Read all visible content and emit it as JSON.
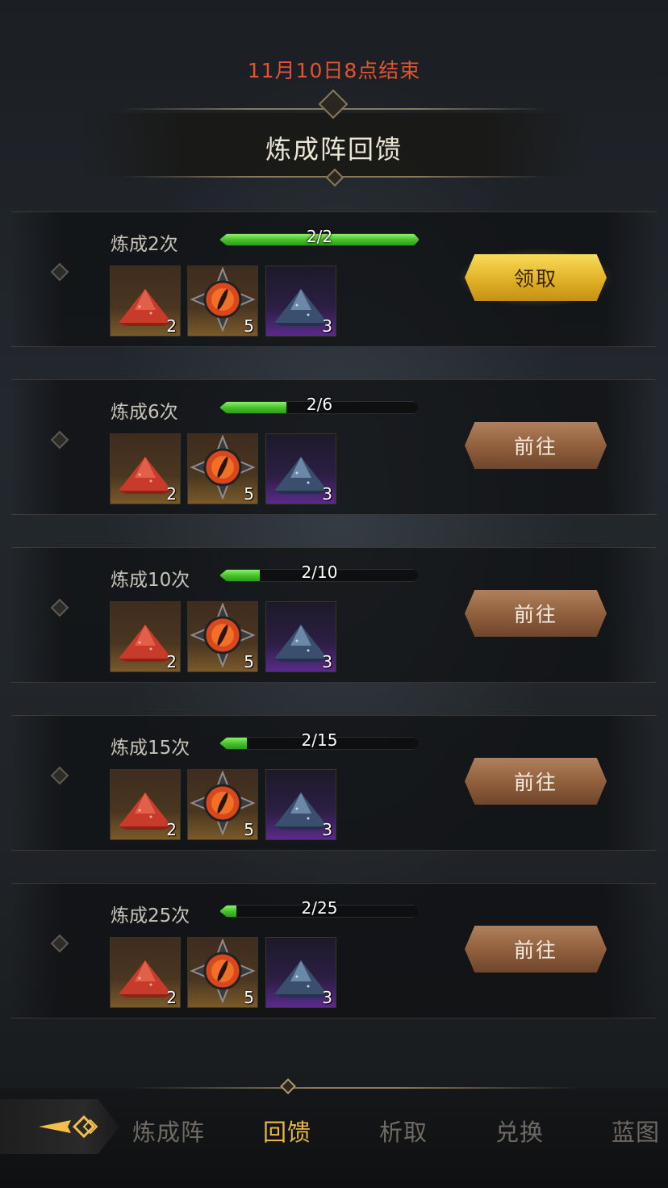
{
  "event": {
    "end_time": "11月10日8点结束",
    "title": "炼成阵回馈"
  },
  "colors": {
    "accent_red": "#e2532f",
    "progress_green": "#47c42a",
    "claim_gold": "#e4b52a",
    "goto_brown": "#8e5e3c",
    "active_tab": "#e8b845"
  },
  "rewards": [
    {
      "label": "炼成2次",
      "progress_text": "2/2",
      "progress_fraction": 1.0,
      "button": "领取",
      "button_type": "claim",
      "items": [
        {
          "icon": "red-crystal-pile-icon",
          "count": "2"
        },
        {
          "icon": "dragon-eye-orb-icon",
          "count": "5"
        },
        {
          "icon": "blue-crystal-pile-icon",
          "count": "3"
        }
      ]
    },
    {
      "label": "炼成6次",
      "progress_text": "2/6",
      "progress_fraction": 0.333,
      "button": "前往",
      "button_type": "goto",
      "items": [
        {
          "icon": "red-crystal-pile-icon",
          "count": "2"
        },
        {
          "icon": "dragon-eye-orb-icon",
          "count": "5"
        },
        {
          "icon": "blue-crystal-pile-icon",
          "count": "3"
        }
      ]
    },
    {
      "label": "炼成10次",
      "progress_text": "2/10",
      "progress_fraction": 0.2,
      "button": "前往",
      "button_type": "goto",
      "items": [
        {
          "icon": "red-crystal-pile-icon",
          "count": "2"
        },
        {
          "icon": "dragon-eye-orb-icon",
          "count": "5"
        },
        {
          "icon": "blue-crystal-pile-icon",
          "count": "3"
        }
      ]
    },
    {
      "label": "炼成15次",
      "progress_text": "2/15",
      "progress_fraction": 0.133,
      "button": "前往",
      "button_type": "goto",
      "items": [
        {
          "icon": "red-crystal-pile-icon",
          "count": "2"
        },
        {
          "icon": "dragon-eye-orb-icon",
          "count": "5"
        },
        {
          "icon": "blue-crystal-pile-icon",
          "count": "3"
        }
      ]
    },
    {
      "label": "炼成25次",
      "progress_text": "2/25",
      "progress_fraction": 0.08,
      "button": "前往",
      "button_type": "goto",
      "items": [
        {
          "icon": "red-crystal-pile-icon",
          "count": "2"
        },
        {
          "icon": "dragon-eye-orb-icon",
          "count": "5"
        },
        {
          "icon": "blue-crystal-pile-icon",
          "count": "3"
        }
      ]
    }
  ],
  "nav": {
    "back_icon": "back-arrow-icon",
    "tabs": [
      {
        "label": "炼成阵",
        "active": false
      },
      {
        "label": "回馈",
        "active": true
      },
      {
        "label": "析取",
        "active": false
      },
      {
        "label": "兑换",
        "active": false
      },
      {
        "label": "蓝图",
        "active": false
      }
    ]
  }
}
